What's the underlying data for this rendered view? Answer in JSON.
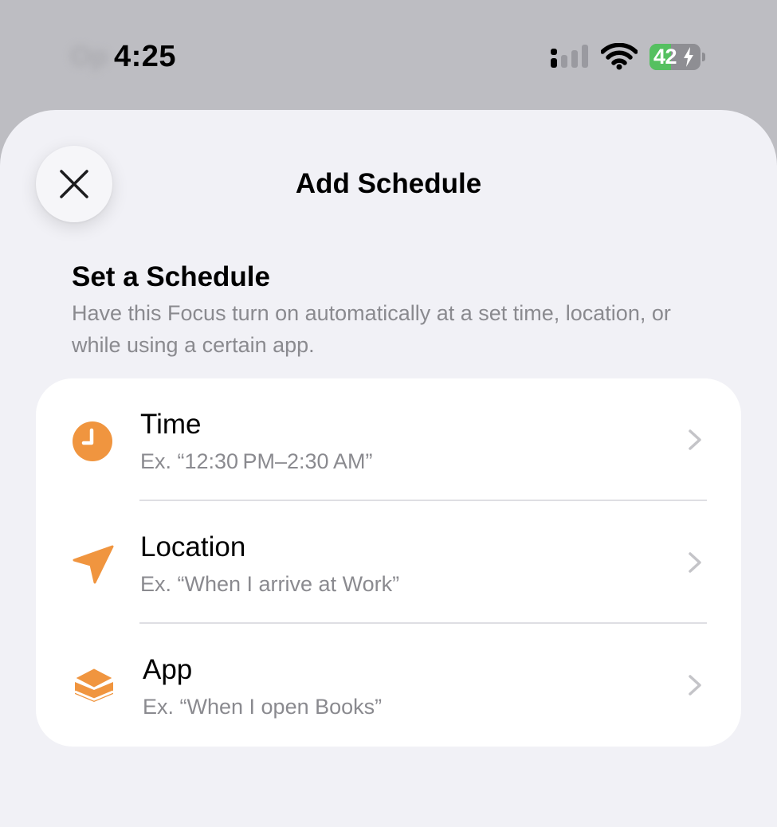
{
  "status_bar": {
    "time": "4:25",
    "carrier_ghost": "Op",
    "battery_percent": "42",
    "battery_level": 0.42,
    "icons": [
      "signal-icon",
      "wifi-icon",
      "battery-icon",
      "charging-bolt-icon"
    ]
  },
  "sheet": {
    "title": "Add Schedule",
    "close_icon": "close-icon"
  },
  "section": {
    "title": "Set a Schedule",
    "description": "Have this Focus turn on automatically at a set time, location, or while using a certain app."
  },
  "options": [
    {
      "label": "Time",
      "example": "Ex. “12:30 PM–2:30 AM”",
      "icon": "clock-icon"
    },
    {
      "label": "Location",
      "example": "Ex. “When I arrive at Work”",
      "icon": "location-arrow-icon"
    },
    {
      "label": "App",
      "example": "Ex. “When I open Books”",
      "icon": "app-stack-icon"
    }
  ],
  "colors": {
    "accent": "#f0953f",
    "background": "#f1f1f6",
    "card": "#ffffff",
    "secondary_text": "#8a8a8f",
    "chevron": "#c4c4c8",
    "battery_green": "#55c060"
  }
}
